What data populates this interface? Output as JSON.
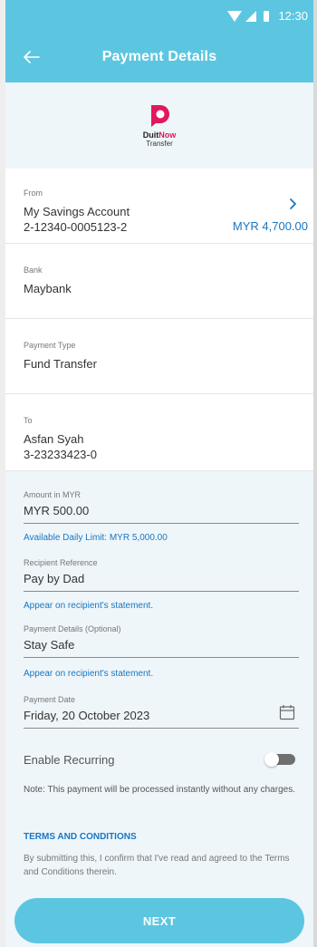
{
  "status_bar": {
    "time": "12:30"
  },
  "app_bar": {
    "title": "Payment Details"
  },
  "logo": {
    "brand_part1": "Duit",
    "brand_part2": "Now",
    "subtitle": "Transfer",
    "accent_color": "#e2175c"
  },
  "from": {
    "label": "From",
    "account_name": "My Savings Account",
    "account_number": "2-12340-0005123-2",
    "balance": "MYR 4,700.00"
  },
  "bank": {
    "label": "Bank",
    "value": "Maybank"
  },
  "payment_type": {
    "label": "Payment Type",
    "value": "Fund Transfer"
  },
  "to": {
    "label": "To",
    "name": "Asfan Syah",
    "account_number": "3-23233423-0"
  },
  "form": {
    "amount": {
      "label": "Amount in MYR",
      "value": "MYR 500.00",
      "helper": "Available Daily Limit: MYR 5,000.00"
    },
    "recipient_reference": {
      "label": "Recipient Reference",
      "value": "Pay by Dad",
      "helper": "Appear on recipient's statement."
    },
    "payment_details": {
      "label": "Payment Details (Optional)",
      "value": "Stay Safe",
      "helper": "Appear on recipient's statement."
    },
    "payment_date": {
      "label": "Payment Date",
      "value": "Friday, 20 October 2023"
    },
    "recurring": {
      "label": "Enable Recurring",
      "enabled": false
    }
  },
  "note": "Note: This payment will be processed instantly without any charges.",
  "terms": {
    "title": "TERMS AND CONDITIONS",
    "text": "By submitting this, I confirm that I've read and agreed to the Terms and Conditions therein."
  },
  "next_button": {
    "label": "NEXT"
  },
  "colors": {
    "primary": "#5cc6e1",
    "link": "#1a76c1",
    "background_tint": "#eef6fa"
  }
}
